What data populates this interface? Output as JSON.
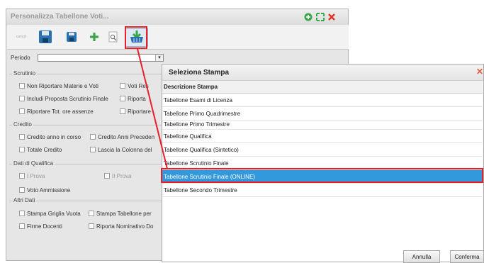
{
  "main": {
    "title": "Personalizza Tabellone Voti...",
    "toolbar": {
      "stamp_label": "cancel"
    },
    "periodo_label": "Periodo",
    "sections": {
      "scrutinio": {
        "legend": "Scrutinio",
        "items": [
          "Non Riportare Materie e Voti",
          "Voti Res",
          "Includi Proposta Scrutinio Finale",
          "Riporta",
          "Riportare Tot. ore assenze",
          "Riportare"
        ]
      },
      "credito": {
        "legend": "Credito",
        "items": [
          "Credito anno in corso",
          "Credito Anni Preceden",
          "Totale Credito",
          "Lascia la Colonna del"
        ]
      },
      "qualifica": {
        "legend": "Dati di Qualifica",
        "items": [
          "I Prova",
          "II Prova",
          "Voto Ammissione"
        ]
      },
      "altri": {
        "legend": "Altri Dati",
        "items": [
          "Stampa Griglia Vuota",
          "Stampa Tabellone per",
          "Firme Docenti",
          "Riporta Nominativo Do"
        ]
      }
    }
  },
  "dialog": {
    "title": "Seleziona Stampa",
    "column_header": "Descrizione Stampa",
    "rows": [
      "Tabellone Esami di Licenza",
      "Tabellone Primo Quadrimestre",
      "Tabellone Primo Trimestre",
      "Tabellone Qualifica",
      "Tabellone Qualifica (Sintetico)",
      "Tabellone Scrutinio Finale",
      "Tabellone Scrutinio Finale (ONLINE)",
      "Tabellone Secondo Trimestre"
    ],
    "selected_row": "Tabellone Scrutinio Finale (ONLINE)",
    "buttons": {
      "cancel": "Annulla",
      "confirm": "Conferma"
    }
  },
  "colors": {
    "highlight": "#e8202a",
    "selection": "#3399dd",
    "accent_green": "#3aa64a",
    "accent_blue": "#2a6fb0"
  }
}
